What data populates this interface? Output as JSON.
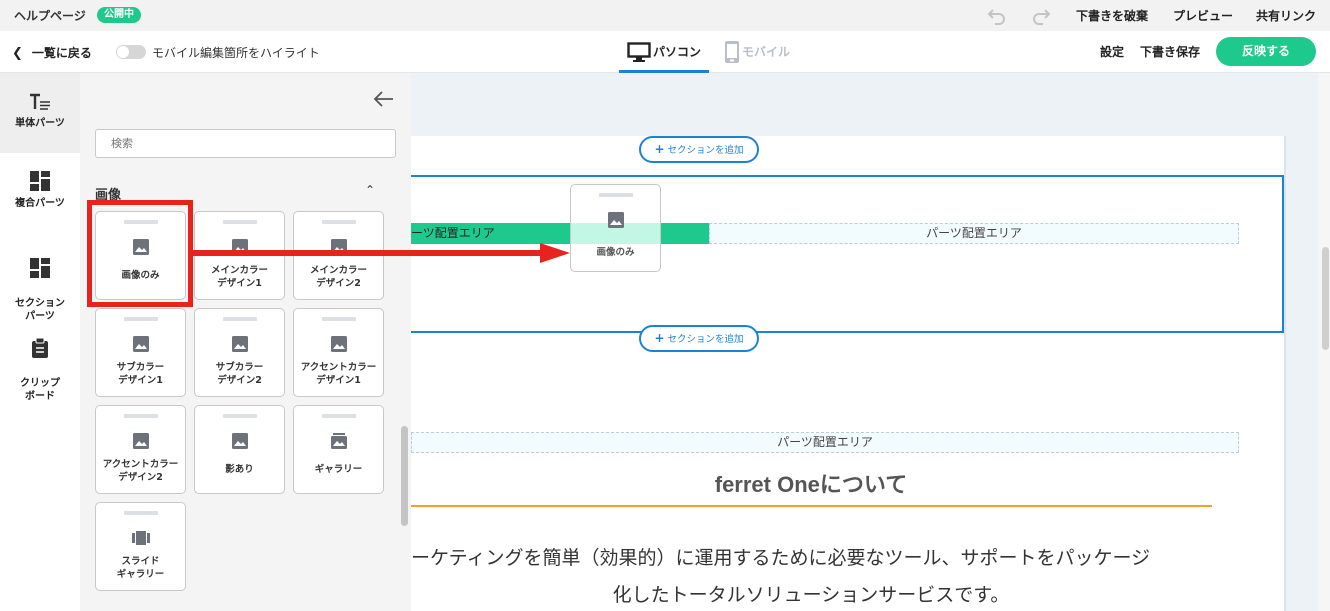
{
  "topbar": {
    "page_title": "ヘルプページ",
    "status_badge": "公開中",
    "discard_draft": "下書きを破棄",
    "preview": "プレビュー",
    "share_link": "共有リンク"
  },
  "toolbar": {
    "back_label": "一覧に戻る",
    "highlight_toggle_label": "モバイル編集箇所をハイライト",
    "device_pc": "パソコン",
    "device_mobile": "モバイル",
    "settings": "設定",
    "save_draft": "下書き保存",
    "publish": "反映する"
  },
  "rail": {
    "items": [
      {
        "label": "単体パーツ",
        "icon": "text-parts-icon",
        "active": true
      },
      {
        "label": "複合パーツ",
        "icon": "grid-parts-icon",
        "active": false
      },
      {
        "label": "セクション\nパーツ",
        "icon": "section-parts-icon",
        "active": false
      },
      {
        "label": "クリップ\nボード",
        "icon": "clipboard-icon",
        "active": false
      }
    ]
  },
  "panel": {
    "search_placeholder": "検索",
    "category": "画像",
    "cards": [
      {
        "label": "画像のみ"
      },
      {
        "label": "メインカラー\nデザイン1"
      },
      {
        "label": "メインカラー\nデザイン2"
      },
      {
        "label": "サブカラー\nデザイン1"
      },
      {
        "label": "サブカラー\nデザイン2"
      },
      {
        "label": "アクセントカラー\nデザイン1"
      },
      {
        "label": "アクセントカラー\nデザイン2"
      },
      {
        "label": "影あり"
      },
      {
        "label": "ギャラリー"
      },
      {
        "label": "スライド\nギャラリー"
      }
    ]
  },
  "canvas": {
    "add_section": "セクションを追加",
    "parts_area": "パーツ配置エリア",
    "parts_area_cut": "ーツ配置エリア",
    "drag_label": "画像のみ",
    "heading": "ferret Oneについて",
    "body_line1": "ーケティングを簡単（効果的）に運用するために必要なツール、サポートをパッケージ",
    "body_line2": "化したトータルソリューションサービスです。"
  },
  "colors": {
    "accent_green": "#1ec98d",
    "accent_blue": "#1a83d8",
    "highlight_red": "#e8221d",
    "heading_rule": "#f3a02a"
  }
}
